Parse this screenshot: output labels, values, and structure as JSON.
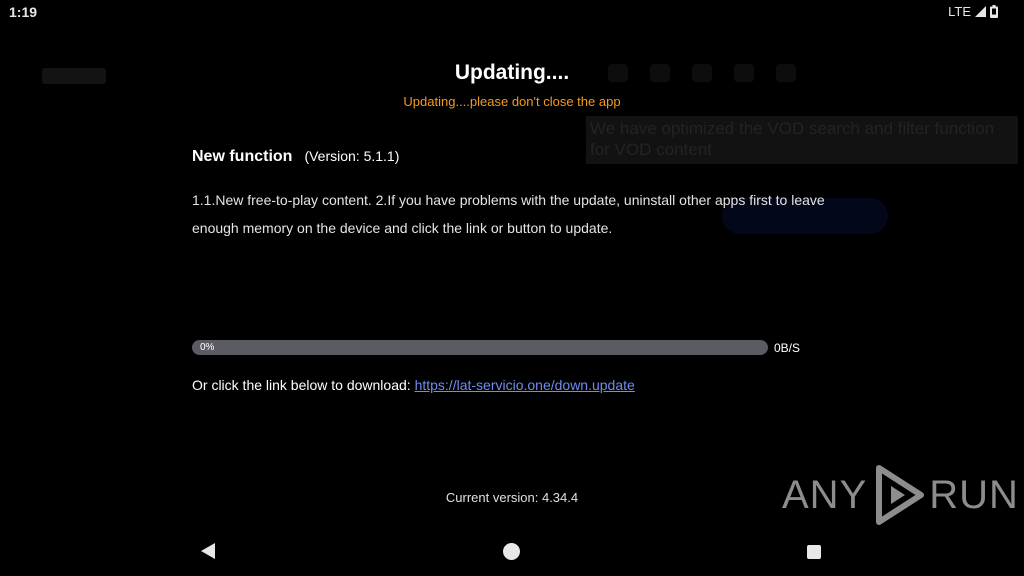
{
  "status_bar": {
    "time": "1:19",
    "network": "LTE",
    "icons": [
      "signal-icon",
      "battery-icon"
    ]
  },
  "background_app": {
    "tooltip_text": "We have optimized the VOD search and filter function for VOD content"
  },
  "dialog": {
    "title": "Updating....",
    "subtitle": "Updating....please don't close the app",
    "section_title": "New function",
    "version_label": "(Version: 5.1.1)",
    "changelog": "1.1.New free-to-play content. 2.If you have problems with the update, uninstall other apps first to leave enough memory on the device and click the link or button to update.",
    "progress": {
      "percent": 0,
      "percent_label": "0%",
      "speed": "0B/S"
    },
    "download_prefix": "Or click the link below to download:",
    "download_link": "https://lat-servicio.one/down.update",
    "current_version": "Current version: 4.34.4"
  },
  "watermark": {
    "text_left": "ANY",
    "text_right": "RUN"
  },
  "nav_bar": {
    "icons": [
      "back-icon",
      "home-icon",
      "recents-icon"
    ]
  },
  "colors": {
    "background": "#000000",
    "subtitle": "#f39b1b",
    "link": "#6d8df0",
    "progress_track": "#5b5b63"
  }
}
